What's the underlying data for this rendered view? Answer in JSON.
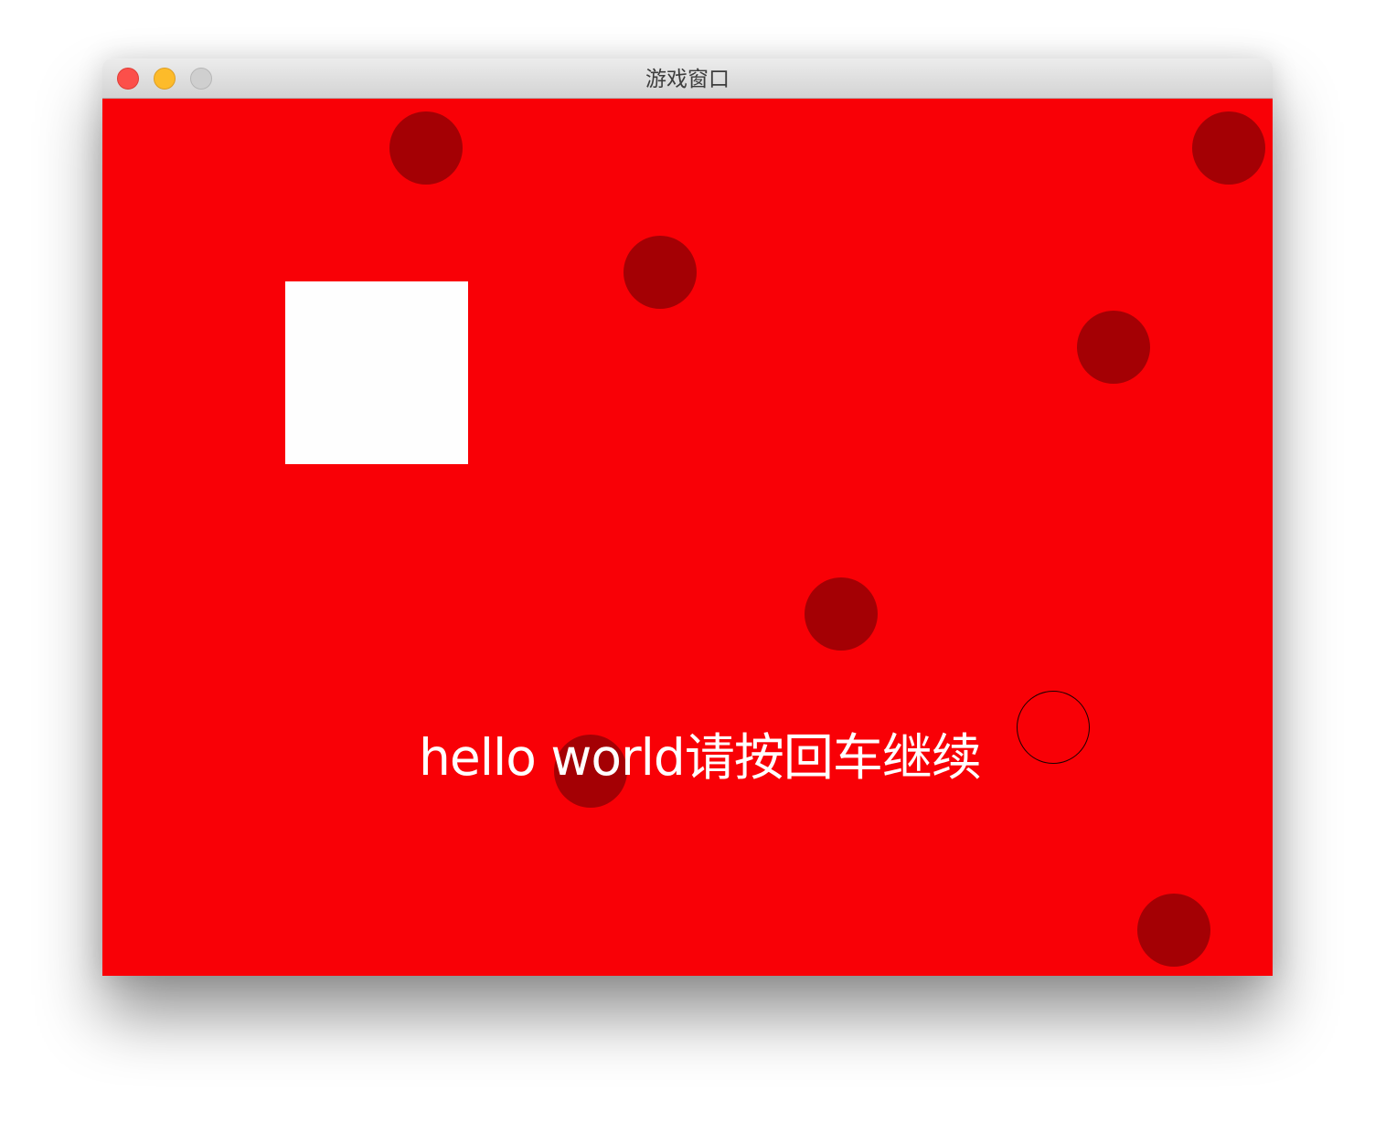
{
  "window": {
    "title": "游戏窗口",
    "buttons": [
      "close",
      "minimize",
      "zoom"
    ]
  },
  "game": {
    "background_color": "#f90006",
    "ball_color": "#a40004",
    "ball_count": 7,
    "player_block_color": "#fefefe",
    "ring_color": "#1a0000",
    "message": "hello world请按回车继续",
    "message_color": "#ffffff"
  }
}
